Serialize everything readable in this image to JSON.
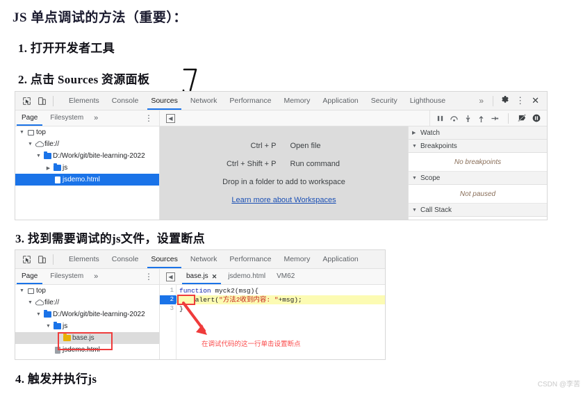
{
  "document": {
    "title": "JS 单点调试的方法（重要）：",
    "steps": [
      {
        "num": "1.",
        "text": "打开开发者工具"
      },
      {
        "num": "2.",
        "text": "点击 Sources 资源面板"
      },
      {
        "num": "3.",
        "text": "找到需要调试的js文件，设置断点"
      },
      {
        "num": "4.",
        "text": "触发并执行js"
      }
    ],
    "step_labels": {
      "s1": "1. 打开开发者工具",
      "s2": "2. 点击 Sources 资源面板",
      "s3": "3. 找到需要调试的js文件，设置断点",
      "s4": "4. 触发并执行js"
    }
  },
  "watermark": "CSDN @李苦",
  "panel1": {
    "toolbar_icons": [
      "inspect-element-icon",
      "device-toolbar-icon"
    ],
    "tabs": [
      {
        "label": "Elements",
        "active": false
      },
      {
        "label": "Console",
        "active": false
      },
      {
        "label": "Sources",
        "active": true
      },
      {
        "label": "Network",
        "active": false
      },
      {
        "label": "Performance",
        "active": false
      },
      {
        "label": "Memory",
        "active": false
      },
      {
        "label": "Application",
        "active": false
      },
      {
        "label": "Security",
        "active": false
      },
      {
        "label": "Lighthouse",
        "active": false
      }
    ],
    "overflow": "»",
    "settings_icon": "gear-icon",
    "kebab_icon": "more-vertical-icon",
    "close_icon": "close-icon",
    "navigator": {
      "tabs": [
        {
          "label": "Page",
          "active": true
        },
        {
          "label": "Filesystem",
          "active": false
        }
      ],
      "more": "»",
      "kebab": "⋮",
      "tree": [
        {
          "label": "top",
          "icon": "frame-icon",
          "indent": 0,
          "caret": "▼",
          "selected": false
        },
        {
          "label": "file://",
          "icon": "cloud-icon",
          "indent": 1,
          "caret": "▼",
          "selected": false
        },
        {
          "label": "D:/Work/git/bite-learning-2022",
          "icon": "folder-icon",
          "indent": 2,
          "caret": "▼",
          "selected": false
        },
        {
          "label": "js",
          "icon": "folder-icon",
          "indent": 3,
          "caret": "▶",
          "selected": false
        },
        {
          "label": "jsdemo.html",
          "icon": "file-icon",
          "indent": 4,
          "caret": "",
          "selected": true
        }
      ]
    },
    "editor_placeholder": {
      "panel_toggle_icon": "show-navigator-icon",
      "shortcuts": [
        {
          "key": "Ctrl + P",
          "desc": "Open file"
        },
        {
          "key": "Ctrl + Shift + P",
          "desc": "Run command"
        }
      ],
      "drop_text": "Drop in a folder to add to workspace",
      "link_text": "Learn more about Workspaces"
    },
    "debugger_buttons": [
      "resume-script-icon",
      "step-over-icon",
      "step-into-icon",
      "step-out-icon",
      "step-icon",
      "deactivate-breakpoints-icon",
      "pause-on-exceptions-icon"
    ],
    "sidebar": [
      {
        "title": "Watch",
        "caret": "▶",
        "content": null
      },
      {
        "title": "Breakpoints",
        "caret": "▼",
        "content": "No breakpoints"
      },
      {
        "title": "Scope",
        "caret": "▼",
        "content": "Not paused"
      },
      {
        "title": "Call Stack",
        "caret": "▼",
        "content": null
      }
    ]
  },
  "panel2": {
    "tabs": [
      {
        "label": "Elements",
        "active": false
      },
      {
        "label": "Console",
        "active": false
      },
      {
        "label": "Sources",
        "active": true
      },
      {
        "label": "Network",
        "active": false
      },
      {
        "label": "Performance",
        "active": false
      },
      {
        "label": "Memory",
        "active": false
      },
      {
        "label": "Application",
        "active": false
      }
    ],
    "navigator": {
      "tabs": [
        {
          "label": "Page",
          "active": true
        },
        {
          "label": "Filesystem",
          "active": false
        }
      ],
      "more": "»",
      "kebab": "⋮",
      "tree": [
        {
          "label": "top",
          "icon": "frame-icon",
          "indent": 0,
          "caret": "▼",
          "selected": false
        },
        {
          "label": "file://",
          "icon": "cloud-icon",
          "indent": 1,
          "caret": "▼",
          "selected": false
        },
        {
          "label": "D:/Work/git/bite-learning-2022",
          "icon": "folder-icon",
          "indent": 2,
          "caret": "▼",
          "selected": false
        },
        {
          "label": "js",
          "icon": "folder-icon",
          "indent": 3,
          "caret": "▼",
          "selected": false
        },
        {
          "label": "base.js",
          "icon": "folder-yellow-icon",
          "indent": 4,
          "caret": "",
          "selected": true
        },
        {
          "label": "jsdemo.html",
          "icon": "file-grey-icon",
          "indent": 4,
          "caret": "",
          "selected": false
        }
      ]
    },
    "editor_tabs": [
      {
        "label": "base.js",
        "active": true,
        "closable": true
      },
      {
        "label": "jsdemo.html",
        "active": false,
        "closable": false
      },
      {
        "label": "VM62",
        "active": false,
        "closable": false
      }
    ],
    "code": {
      "lines": [
        {
          "num": "1",
          "text": "function myck2(msg){",
          "breakpoint": false,
          "highlighted": false
        },
        {
          "num": "2",
          "text": "    alert(\"方法2收到内容: \"+msg);",
          "breakpoint": true,
          "highlighted": true
        },
        {
          "num": "3",
          "text": "}",
          "breakpoint": false,
          "highlighted": false
        }
      ]
    },
    "annotation": {
      "text": "在调试代码的这一行单击设置断点",
      "color": "#fa4a4a"
    }
  }
}
